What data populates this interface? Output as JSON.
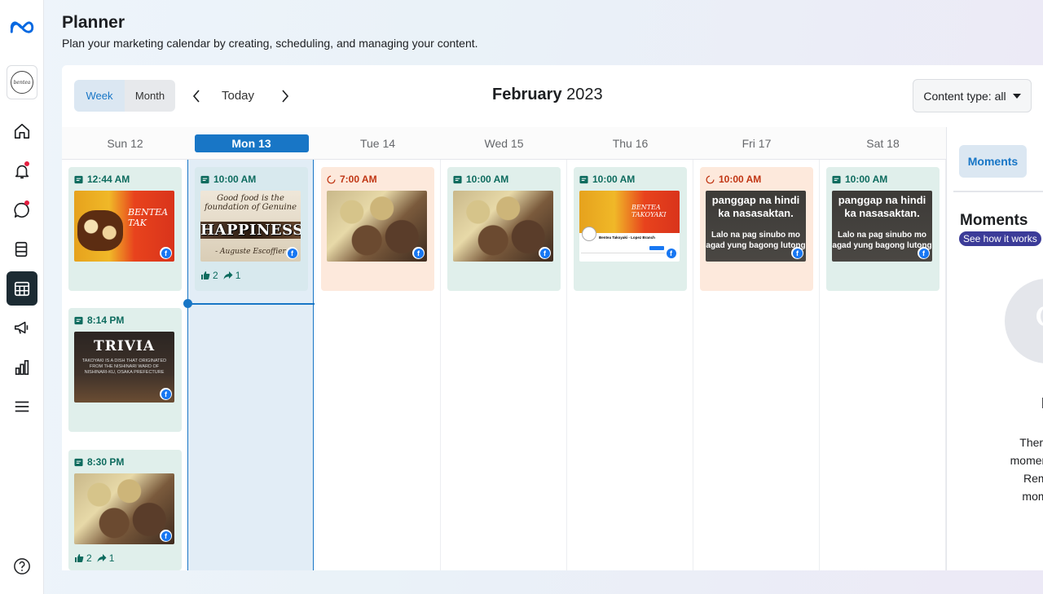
{
  "header": {
    "title": "Planner",
    "subtitle": "Plan your marketing calendar by creating, scheduling, and managing your content."
  },
  "rail": {
    "items": [
      {
        "icon": "home-icon"
      },
      {
        "icon": "bell-icon",
        "has_dot": true
      },
      {
        "icon": "chat-bubble-icon",
        "has_dot": true
      },
      {
        "icon": "pages-icon"
      },
      {
        "icon": "calendar-icon",
        "active": true
      },
      {
        "icon": "megaphone-icon"
      },
      {
        "icon": "bar-chart-icon"
      },
      {
        "icon": "menu-icon"
      }
    ],
    "help_icon": "question-icon"
  },
  "toolbar": {
    "week_label": "Week",
    "month_label": "Month",
    "today_label": "Today",
    "month_name": "February",
    "year": "2023",
    "content_type_label": "Content type: all"
  },
  "calendar": {
    "days": [
      "Sun 12",
      "Mon 13",
      "Tue 14",
      "Wed 15",
      "Thu 16",
      "Fri 17",
      "Sat 18"
    ],
    "today_index": 1,
    "posts": [
      {
        "day": "Sun 12",
        "time": "12:44 AM",
        "status": "scheduled",
        "image": "bentea",
        "text": "BENTEA TAK"
      },
      {
        "day": "Sun 12",
        "time": "8:14 PM",
        "status": "scheduled",
        "image": "trivia",
        "heading": "TRIVIA",
        "text": "TAKOYAKI IS A DISH THAT ORIGINATED FROM THE NISHINARI WARD OF NISHINARI-KU, OSAKA PREFECTURE"
      },
      {
        "day": "Sun 12",
        "time": "8:30 PM",
        "status": "published",
        "image": "food",
        "likes": "2",
        "shares": "1"
      },
      {
        "day": "Mon 13",
        "time": "10:00 AM",
        "status": "published",
        "image": "happiness",
        "line1": "Good food is the foundation of Genuine",
        "line2": "HAPPINESS",
        "line3": "- Auguste Escoffier",
        "likes": "2",
        "shares": "1"
      },
      {
        "day": "Tue 14",
        "time": "7:00 AM",
        "status": "draft",
        "image": "food"
      },
      {
        "day": "Wed 15",
        "time": "10:00 AM",
        "status": "scheduled",
        "image": "food"
      },
      {
        "day": "Thu 16",
        "time": "10:00 AM",
        "status": "scheduled",
        "image": "page",
        "text": "BENTEA TAKOYAKI",
        "page_name": "Bentea Takoyaki - Lopez Branch"
      },
      {
        "day": "Fri 17",
        "time": "10:00 AM",
        "status": "draft",
        "image": "text",
        "big": "panggap na hindi ka nasasaktan.",
        "small": "Lalo na pag sinubo mo agad yung bagong lutong"
      },
      {
        "day": "Sat 18",
        "time": "10:00 AM",
        "status": "scheduled",
        "image": "text",
        "big": "panggap na hindi ka nasasaktan.",
        "small": "Lalo na pag sinubo mo agad yung bagong lutong"
      }
    ]
  },
  "side": {
    "tab_label": "Moments",
    "title": "Moments",
    "see_how_label": "See how it works",
    "empty_title": "No u\nmo",
    "empty_text": "There are\nmoments in\nReminde\nmoments"
  },
  "colors": {
    "accent": "#1876c6",
    "scheduled_bg": "#e0efeb",
    "draft_bg": "#fde9dc",
    "scheduled_text": "#0d6b5e",
    "draft_text": "#c03513"
  }
}
